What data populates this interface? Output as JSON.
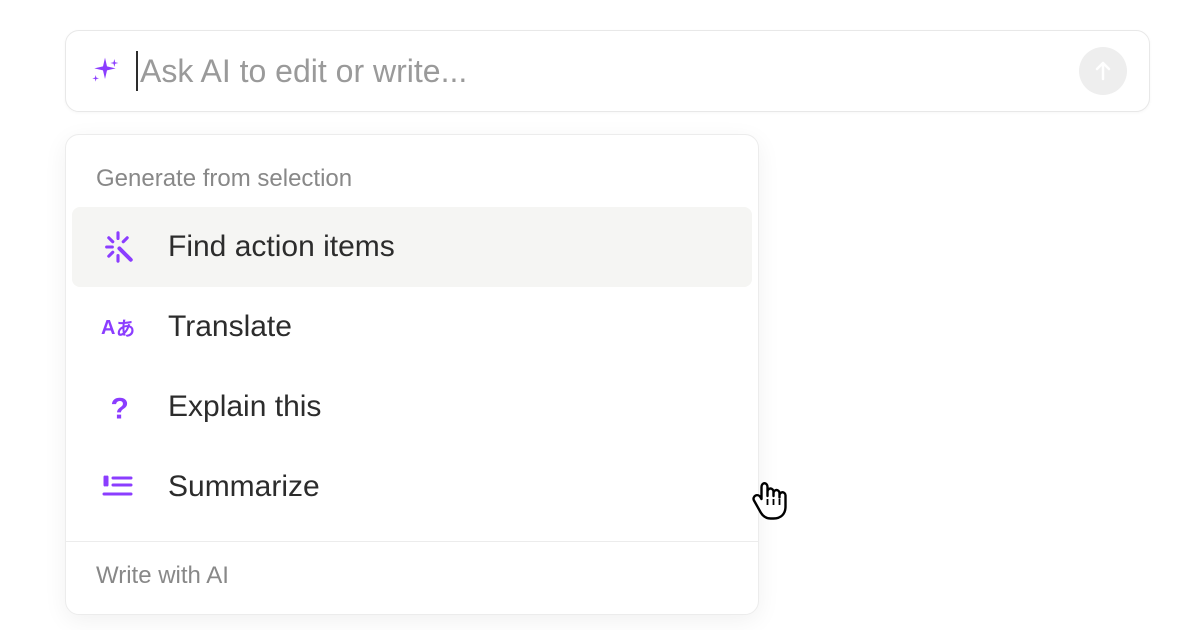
{
  "colors": {
    "accent": "#8b3dff",
    "placeholder": "#9a9a9a",
    "section_label": "#888888",
    "text": "#2c2c2c"
  },
  "input": {
    "placeholder": "Ask AI to edit or write...",
    "value": ""
  },
  "dropdown": {
    "section1_label": "Generate from selection",
    "items": [
      {
        "icon": "magic-wand-icon",
        "label": "Find action items",
        "selected": true
      },
      {
        "icon": "translate-icon",
        "label": "Translate",
        "selected": false
      },
      {
        "icon": "question-icon",
        "label": "Explain this",
        "selected": false
      },
      {
        "icon": "summarize-icon",
        "label": "Summarize",
        "selected": false
      }
    ],
    "section2_label": "Write with AI"
  }
}
